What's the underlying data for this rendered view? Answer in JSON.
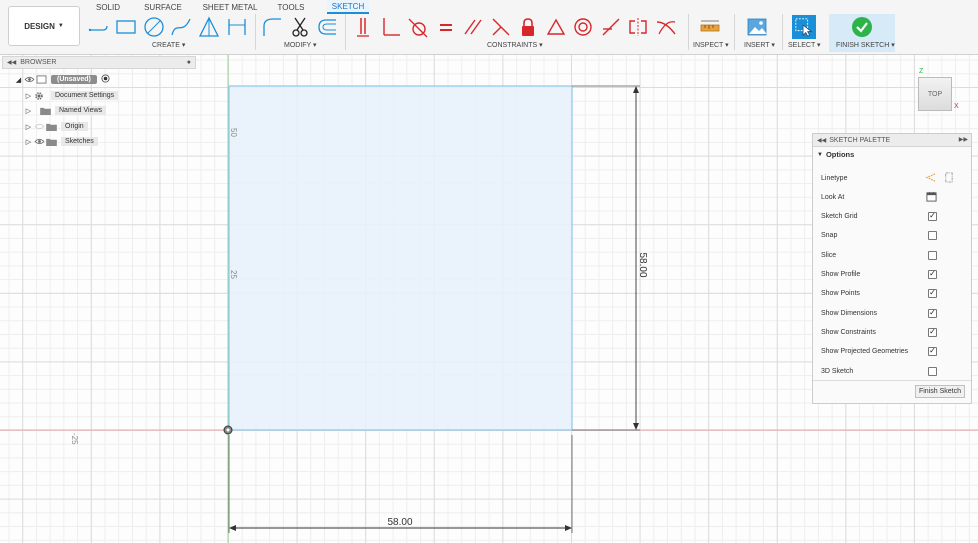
{
  "toolbar": {
    "design_label": "DESIGN",
    "tabs": [
      "SOLID",
      "SURFACE",
      "SHEET METAL",
      "TOOLS",
      "SKETCH"
    ],
    "groups": {
      "create": "CREATE",
      "modify": "MODIFY",
      "constraints": "CONSTRAINTS",
      "inspect": "INSPECT",
      "insert": "INSERT",
      "select": "SELECT",
      "finish": "FINISH SKETCH"
    }
  },
  "browser": {
    "title": "BROWSER",
    "root": "(Unsaved)",
    "items": [
      "Document Settings",
      "Named Views",
      "Origin",
      "Sketches"
    ]
  },
  "canvas": {
    "axis_labels": {
      "y50": "50",
      "y25": "25",
      "xneg25": "-25"
    },
    "dimensions": {
      "width": "58.00",
      "height": "58.00"
    }
  },
  "viewcube": {
    "face": "TOP",
    "x": "X",
    "z": "Z"
  },
  "palette": {
    "title": "SKETCH PALETTE",
    "section": "Options",
    "options": [
      {
        "label": "Linetype",
        "kind": "linetype"
      },
      {
        "label": "Look At",
        "kind": "lookat"
      },
      {
        "label": "Sketch Grid",
        "checked": "✓"
      },
      {
        "label": "Snap",
        "checked": ""
      },
      {
        "label": "Slice",
        "checked": ""
      },
      {
        "label": "Show Profile",
        "checked": "✓"
      },
      {
        "label": "Show Points",
        "checked": "✓"
      },
      {
        "label": "Show Dimensions",
        "checked": "✓"
      },
      {
        "label": "Show Constraints",
        "checked": "✓"
      },
      {
        "label": "Show Projected Geometries",
        "checked": "✓"
      },
      {
        "label": "3D Sketch",
        "checked": ""
      }
    ],
    "finish_button": "Finish Sketch"
  },
  "colors": {
    "accent": "#1a8fd8",
    "constraint_red": "#d8272c",
    "profile_fill": "#e6f1fb",
    "sketch_line": "#8ec8ea",
    "axis_red": "#f2a6a6",
    "axis_green": "#9fd69f",
    "finish_green": "#2eb34a"
  }
}
